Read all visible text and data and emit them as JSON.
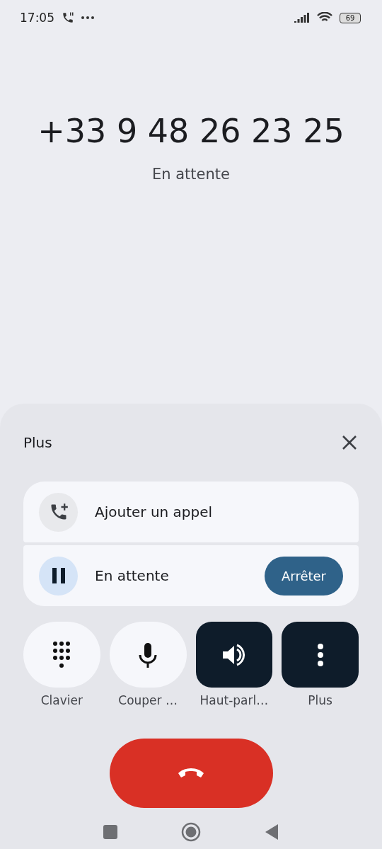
{
  "status_bar": {
    "time": "17:05",
    "battery": "69"
  },
  "call": {
    "number": "+33 9 48 26 23 25",
    "status": "En attente"
  },
  "sheet": {
    "title": "Plus",
    "rows": [
      {
        "kind": "add_call",
        "label": "Ajouter un appel",
        "active": false
      },
      {
        "kind": "hold",
        "label": "En attente",
        "active": true,
        "action": "Arrêter"
      }
    ],
    "controls": [
      {
        "kind": "keypad",
        "label": "Clavier",
        "active": false
      },
      {
        "kind": "mic",
        "label": "Couper …",
        "active": false
      },
      {
        "kind": "speaker",
        "label": "Haut-parl…",
        "active": true
      },
      {
        "kind": "more",
        "label": "Plus",
        "active": true
      }
    ]
  }
}
